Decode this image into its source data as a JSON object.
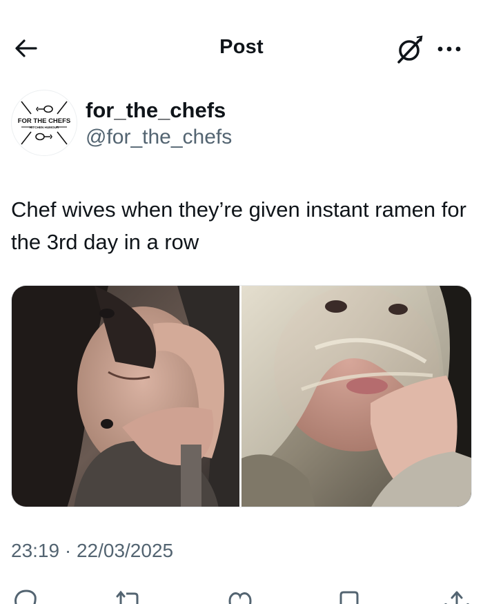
{
  "header": {
    "title": "Post",
    "back_icon": "arrow-left-icon",
    "grok_icon": "grok-icon",
    "more_icon": "more-horizontal-icon"
  },
  "author": {
    "display_name": "for_the_chefs",
    "handle": "@for_the_chefs",
    "avatar": {
      "logo_text": "FOR THE CHEFS",
      "logo_subtext": "KITCHEN HUMOUR"
    }
  },
  "post": {
    "text": "Chef wives when they’re given instant ramen for the 3rd day in a row",
    "media": {
      "type": "photo-collage",
      "panels": 2
    },
    "timestamp": "23:19 · 22/03/2025"
  },
  "actions": [
    {
      "name": "reply",
      "icon": "reply-icon"
    },
    {
      "name": "repost",
      "icon": "repost-icon"
    },
    {
      "name": "like",
      "icon": "heart-icon"
    },
    {
      "name": "bookmark",
      "icon": "bookmark-icon"
    },
    {
      "name": "share",
      "icon": "share-icon"
    }
  ],
  "colors": {
    "text_primary": "#0f1419",
    "text_secondary": "#536471",
    "border": "#e6e9ec"
  }
}
